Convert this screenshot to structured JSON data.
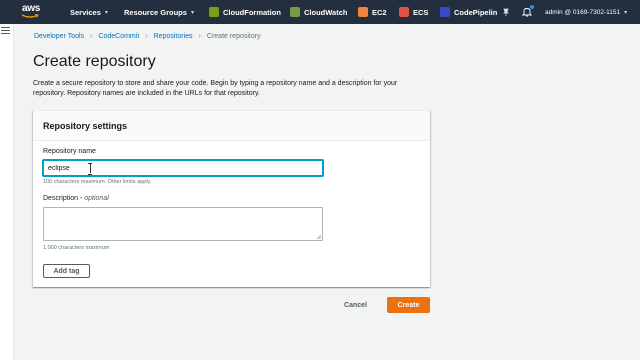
{
  "topnav": {
    "logo_text": "aws",
    "services_label": "Services",
    "resource_groups_label": "Resource Groups",
    "pinned": [
      {
        "label": "CloudFormation",
        "icon": "cloudformation-icon",
        "color": "#7aa116"
      },
      {
        "label": "CloudWatch",
        "icon": "cloudwatch-icon",
        "color": "#759c3e"
      },
      {
        "label": "EC2",
        "icon": "ec2-icon",
        "color": "#f58536"
      },
      {
        "label": "ECS",
        "icon": "ecs-icon",
        "color": "#e05243"
      },
      {
        "label": "CodePipelin",
        "icon": "codepipeline-icon",
        "color": "#3b48cc"
      }
    ],
    "account_label": "admin @ 0169-7302-1151"
  },
  "breadcrumb": {
    "items": [
      "Developer Tools",
      "CodeCommit",
      "Repositories"
    ],
    "current": "Create repository"
  },
  "page": {
    "title": "Create repository",
    "description": "Create a secure repository to store and share your code. Begin by typing a repository name and a description for your repository. Repository names are included in the URLs for that repository."
  },
  "settings": {
    "title": "Repository settings",
    "name_label": "Repository name",
    "name_value": "eclipse",
    "name_hint": "100 characters maximum. Other limits apply.",
    "description_label": "Description",
    "description_optional": "optional",
    "description_value": "",
    "description_hint": "1,000 characters maximum",
    "add_tag_label": "Add tag"
  },
  "actions": {
    "cancel_label": "Cancel",
    "create_label": "Create"
  },
  "colors": {
    "nav_bg": "#232f3e",
    "primary_button": "#ec7211",
    "link": "#0073bb",
    "focus": "#00a1c9"
  }
}
